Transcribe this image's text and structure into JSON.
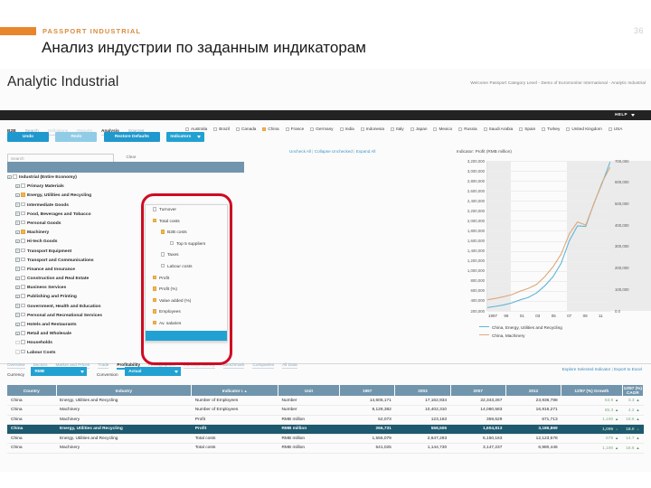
{
  "slide": {
    "brand": "PASSPORT INDUSTRIAL",
    "page_number": "36",
    "title": "Анализ индустрии по заданным индикаторам",
    "accent_orange": "#e8862b"
  },
  "app": {
    "logo": "Analytic Industrial",
    "welcome": "Welcome Passport Category Level - Demo of Euromonitor International - Analytic Industrial",
    "help_label": "HELP",
    "accent_blue": "#19a0d4",
    "header_blue": "#6e93ad",
    "selected_row_color": "#15556b"
  },
  "nav": {
    "items": [
      {
        "label": "B2B",
        "state": "dark"
      },
      {
        "label": "Search",
        "state": "link"
      },
      {
        "label": "Definitions",
        "state": "dim"
      },
      {
        "label": "Reports",
        "state": "dim"
      },
      {
        "label": "Analysis",
        "state": "dark"
      },
      {
        "label": "Sources",
        "state": "link"
      }
    ]
  },
  "toolbar": {
    "undo": "Undo",
    "redo": "Redo",
    "restore_defaults": "Restore Defaults",
    "indicators": "Indicators"
  },
  "countries": [
    {
      "label": "Australia",
      "checked": false
    },
    {
      "label": "Brazil",
      "checked": false
    },
    {
      "label": "Canada",
      "checked": false
    },
    {
      "label": "China",
      "checked": true
    },
    {
      "label": "France",
      "checked": false
    },
    {
      "label": "Germany",
      "checked": false
    },
    {
      "label": "India",
      "checked": false
    },
    {
      "label": "Indonesia",
      "checked": false
    },
    {
      "label": "Italy",
      "checked": false
    },
    {
      "label": "Japan",
      "checked": false
    },
    {
      "label": "Mexico",
      "checked": false
    },
    {
      "label": "Russia",
      "checked": false
    },
    {
      "label": "Saudi Arabia",
      "checked": false
    },
    {
      "label": "Spain",
      "checked": false
    },
    {
      "label": "Turkey",
      "checked": false
    },
    {
      "label": "United Kingdom",
      "checked": false
    },
    {
      "label": "USA",
      "checked": false
    }
  ],
  "tree_links": {
    "uncheck_all": "Uncheck All",
    "collapse_unchecked": "Collapse Unchecked",
    "expand_all": "Expand All",
    "sep": "|"
  },
  "search": {
    "placeholder": "Search",
    "value": "",
    "clear_label": "Clear"
  },
  "tree": [
    {
      "label": "Industrial (Entire Economy)",
      "level": 0,
      "checked": false,
      "expandable": true
    },
    {
      "label": "Primary Materials",
      "level": 1,
      "checked": false,
      "expandable": true
    },
    {
      "label": "Energy, Utilities and Recycling",
      "level": 1,
      "checked": true,
      "expandable": true
    },
    {
      "label": "Intermediate Goods",
      "level": 1,
      "checked": false,
      "expandable": true
    },
    {
      "label": "Food, Beverages and Tobacco",
      "level": 1,
      "checked": false,
      "expandable": true
    },
    {
      "label": "Personal Goods",
      "level": 1,
      "checked": false,
      "expandable": true
    },
    {
      "label": "Machinery",
      "level": 1,
      "checked": true,
      "expandable": true
    },
    {
      "label": "Hi-tech Goods",
      "level": 1,
      "checked": false,
      "expandable": true
    },
    {
      "label": "Transport Equipment",
      "level": 1,
      "checked": false,
      "expandable": true
    },
    {
      "label": "Transport and Communications",
      "level": 1,
      "checked": false,
      "expandable": true
    },
    {
      "label": "Finance and Insurance",
      "level": 1,
      "checked": false,
      "expandable": true
    },
    {
      "label": "Construction and Real Estate",
      "level": 1,
      "checked": false,
      "expandable": true
    },
    {
      "label": "Business Services",
      "level": 1,
      "checked": false,
      "expandable": true
    },
    {
      "label": "Publishing and Printing",
      "level": 1,
      "checked": false,
      "expandable": true
    },
    {
      "label": "Government, Health and Education",
      "level": 1,
      "checked": false,
      "expandable": true
    },
    {
      "label": "Personal and Recreational Services",
      "level": 1,
      "checked": false,
      "expandable": true
    },
    {
      "label": "Hotels and Restaurants",
      "level": 1,
      "checked": false,
      "expandable": true
    },
    {
      "label": "Retail and Wholesale",
      "level": 1,
      "checked": false,
      "expandable": true
    },
    {
      "label": "Households",
      "level": 1,
      "checked": false,
      "expandable": false
    },
    {
      "label": "Labour Costs",
      "level": 1,
      "checked": false,
      "expandable": false
    }
  ],
  "indicators_dropdown": [
    {
      "label": "Turnover",
      "level": 0,
      "checked": false
    },
    {
      "label": "Total costs",
      "level": 0,
      "checked": true
    },
    {
      "label": "B2B costs",
      "level": 1,
      "checked": true
    },
    {
      "label": "Top 5 suppliers",
      "level": 2,
      "checked": false
    },
    {
      "label": "Taxes",
      "level": 1,
      "checked": false
    },
    {
      "label": "Labour costs",
      "level": 1,
      "checked": false
    },
    {
      "label": "Profit",
      "level": 0,
      "checked": true
    },
    {
      "label": "Profit (%)",
      "level": 0,
      "checked": true
    },
    {
      "label": "Value added (%)",
      "level": 0,
      "checked": true
    },
    {
      "label": "Employees",
      "level": 0,
      "checked": true
    },
    {
      "label": "Av. salaries",
      "level": 0,
      "checked": true
    }
  ],
  "chart_data": {
    "type": "line",
    "title": "Indicator: Profit (RMB million)",
    "xlabel": "",
    "ylabel": "",
    "grid": true,
    "legend_position": "bottom-left",
    "x": [
      1997,
      1998,
      1999,
      2000,
      2001,
      2002,
      2003,
      2004,
      2005,
      2006,
      2007,
      2008,
      2009,
      2010,
      2011,
      2012
    ],
    "xticks": [
      "1997",
      "99",
      "01",
      "03",
      "05",
      "07",
      "09",
      "11"
    ],
    "yticks_left": [
      "200,000",
      "400,000",
      "600,000",
      "800,000",
      "1,000,000",
      "1,200,000",
      "1,400,000",
      "1,600,000",
      "1,800,000",
      "2,000,000",
      "2,200,000",
      "2,400,000",
      "2,600,000",
      "2,800,000",
      "3,000,000",
      "3,200,000"
    ],
    "ylim_left": [
      200000,
      3200000
    ],
    "yticks_right": [
      "0.0",
      "100,000",
      "200,000",
      "300,000",
      "400,000",
      "500,000",
      "600,000",
      "700,000"
    ],
    "ylim_right": [
      0,
      700000
    ],
    "series": [
      {
        "name": "China, Energy, Utilities and Recycling",
        "color": "#5bb6d8",
        "axis": "left",
        "values": [
          266731,
          290000,
          320000,
          360000,
          420000,
          470000,
          558506,
          700000,
          880000,
          1150000,
          1604813,
          1900000,
          1890000,
          2350000,
          2750000,
          3186869
        ]
      },
      {
        "name": "China, Machinery",
        "color": "#e0a878",
        "axis": "right",
        "values": [
          52073,
          58000,
          66000,
          76000,
          92000,
          105000,
          123163,
          160000,
          205000,
          265000,
          359629,
          415000,
          400000,
          500000,
          600000,
          671713
        ]
      }
    ]
  },
  "lower_nav": {
    "items": [
      {
        "label": "Overview",
        "active": false
      },
      {
        "label": "Sectors",
        "active": false
      },
      {
        "label": "Market and Prices",
        "active": false
      },
      {
        "label": "Trade",
        "active": false
      },
      {
        "label": "Profitability",
        "active": true
      },
      {
        "label": "Firmographics",
        "active": false
      },
      {
        "label": "Interdependency",
        "active": false
      },
      {
        "label": "Benchmark",
        "active": false
      },
      {
        "label": "Companies",
        "active": false
      },
      {
        "label": "All Data",
        "active": false
      }
    ]
  },
  "controls": {
    "currency_label": "Currency",
    "currency_value": "RMB",
    "conversion_label": "Conversion",
    "conversion_value": "Actual",
    "explore_link": "Explore Selected Indicator",
    "export_link": "Export to Excel",
    "sep": "|"
  },
  "table": {
    "columns": [
      "Country",
      "Industry",
      "Indicator",
      "Unit",
      "1997",
      "2003",
      "2007",
      "2012",
      "12/97 (%) Growth",
      "12/97 (%) CAGR"
    ],
    "sorted_column": "Indicator",
    "sort_mark": "1 ▲",
    "rows": [
      {
        "selected": false,
        "cells": [
          "China",
          "Energy, Utilities and Recycling",
          "Number of Employees",
          "Number",
          "14,605,171",
          "17,162,934",
          "22,343,267",
          "23,936,788",
          "63.9",
          "3.3"
        ]
      },
      {
        "selected": false,
        "cells": [
          "China",
          "Machinery",
          "Number of Employees",
          "Number",
          "9,128,382",
          "10,402,310",
          "14,080,583",
          "16,916,271",
          "85.3",
          "4.2"
        ]
      },
      {
        "selected": false,
        "cells": [
          "China",
          "Machinery",
          "Profit",
          "RMB million",
          "52,073",
          "123,163",
          "359,629",
          "671,713",
          "1,190",
          "18.6"
        ]
      },
      {
        "selected": true,
        "cells": [
          "China",
          "Energy, Utilities and Recycling",
          "Profit",
          "RMB million",
          "266,731",
          "558,506",
          "1,604,813",
          "3,186,869",
          "1,095",
          "18.0"
        ]
      },
      {
        "selected": false,
        "cells": [
          "China",
          "Energy, Utilities and Recycling",
          "Total costs",
          "RMB million",
          "1,556,079",
          "2,647,293",
          "6,150,163",
          "12,123,578",
          "679",
          "14.7"
        ]
      },
      {
        "selected": false,
        "cells": [
          "China",
          "Machinery",
          "Total costs",
          "RMB million",
          "541,025",
          "1,144,730",
          "3,147,237",
          "6,980,446",
          "1,190",
          "18.6"
        ]
      }
    ]
  }
}
